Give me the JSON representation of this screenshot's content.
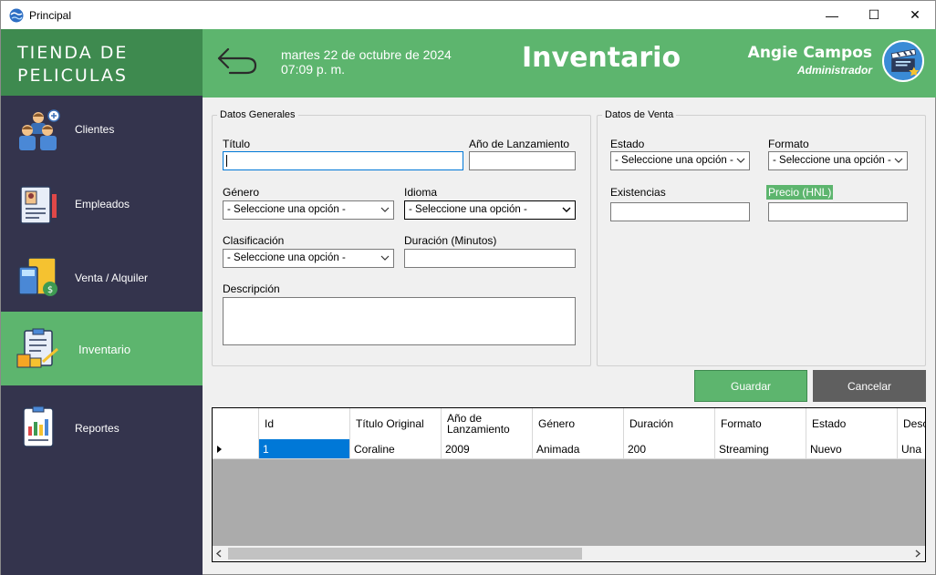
{
  "window": {
    "title": "Principal",
    "minimize": "—",
    "maximize": "☐",
    "close": "✕"
  },
  "sidebar": {
    "logo_line1": "TIENDA DE",
    "logo_line2": "PELICULAS",
    "items": [
      {
        "label": "Clientes",
        "icon": "clients-icon"
      },
      {
        "label": "Empleados",
        "icon": "employees-icon"
      },
      {
        "label": "Venta / Alquiler",
        "icon": "sales-icon"
      },
      {
        "label": "Inventario",
        "icon": "inventory-icon",
        "active": true
      },
      {
        "label": "Reportes",
        "icon": "reports-icon"
      }
    ]
  },
  "header": {
    "date_line1": "martes 22 de octubre de 2024",
    "date_line2": "07:09 p. m.",
    "title": "Inventario",
    "user_name": "Angie Campos",
    "user_role": "Administrador"
  },
  "general": {
    "legend": "Datos Generales",
    "titulo_label": "Título",
    "titulo_value": "",
    "anio_label": "Año de Lanzamiento",
    "anio_value": "",
    "genero_label": "Género",
    "genero_value": "- Seleccione una opción -",
    "idioma_label": "Idioma",
    "idioma_value": "- Seleccione una opción -",
    "clasificacion_label": "Clasificación",
    "clasificacion_value": "- Seleccione una opción -",
    "duracion_label": "Duración (Minutos)",
    "duracion_value": "",
    "descripcion_label": "Descripción",
    "descripcion_value": ""
  },
  "venta": {
    "legend": "Datos de Venta",
    "estado_label": "Estado",
    "estado_value": "- Seleccione una opción -",
    "formato_label": "Formato",
    "formato_value": "- Seleccione una opción -",
    "existencias_label": "Existencias",
    "existencias_value": "",
    "precio_label": "Precio (HNL)",
    "precio_value": ""
  },
  "buttons": {
    "save": "Guardar",
    "cancel": "Cancelar"
  },
  "table": {
    "columns": [
      "Id",
      "Título Original",
      "Año de Lanzamiento",
      "Género",
      "Duración",
      "Formato",
      "Estado",
      "Desc"
    ],
    "rows": [
      [
        "1",
        "Coraline",
        "2009",
        "Animada",
        "200",
        "Streaming",
        "Nuevo",
        "Una n"
      ]
    ]
  },
  "colors": {
    "accent": "#5db56e",
    "dark_accent": "#3e8a4f",
    "sidebar": "#34344d",
    "cancel": "#5f5f5f"
  }
}
